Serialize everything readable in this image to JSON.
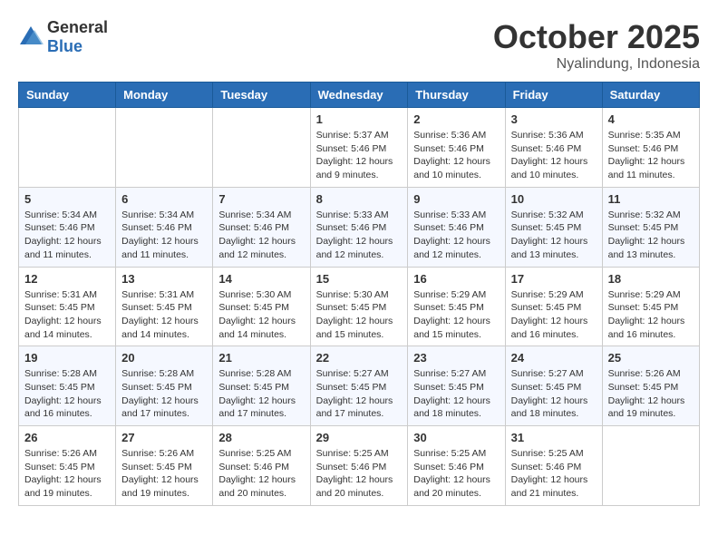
{
  "header": {
    "logo_general": "General",
    "logo_blue": "Blue",
    "month": "October 2025",
    "location": "Nyalindung, Indonesia"
  },
  "days_of_week": [
    "Sunday",
    "Monday",
    "Tuesday",
    "Wednesday",
    "Thursday",
    "Friday",
    "Saturday"
  ],
  "weeks": [
    [
      {
        "day": "",
        "info": ""
      },
      {
        "day": "",
        "info": ""
      },
      {
        "day": "",
        "info": ""
      },
      {
        "day": "1",
        "info": "Sunrise: 5:37 AM\nSunset: 5:46 PM\nDaylight: 12 hours and 9 minutes."
      },
      {
        "day": "2",
        "info": "Sunrise: 5:36 AM\nSunset: 5:46 PM\nDaylight: 12 hours and 10 minutes."
      },
      {
        "day": "3",
        "info": "Sunrise: 5:36 AM\nSunset: 5:46 PM\nDaylight: 12 hours and 10 minutes."
      },
      {
        "day": "4",
        "info": "Sunrise: 5:35 AM\nSunset: 5:46 PM\nDaylight: 12 hours and 11 minutes."
      }
    ],
    [
      {
        "day": "5",
        "info": "Sunrise: 5:34 AM\nSunset: 5:46 PM\nDaylight: 12 hours and 11 minutes."
      },
      {
        "day": "6",
        "info": "Sunrise: 5:34 AM\nSunset: 5:46 PM\nDaylight: 12 hours and 11 minutes."
      },
      {
        "day": "7",
        "info": "Sunrise: 5:34 AM\nSunset: 5:46 PM\nDaylight: 12 hours and 12 minutes."
      },
      {
        "day": "8",
        "info": "Sunrise: 5:33 AM\nSunset: 5:46 PM\nDaylight: 12 hours and 12 minutes."
      },
      {
        "day": "9",
        "info": "Sunrise: 5:33 AM\nSunset: 5:46 PM\nDaylight: 12 hours and 12 minutes."
      },
      {
        "day": "10",
        "info": "Sunrise: 5:32 AM\nSunset: 5:45 PM\nDaylight: 12 hours and 13 minutes."
      },
      {
        "day": "11",
        "info": "Sunrise: 5:32 AM\nSunset: 5:45 PM\nDaylight: 12 hours and 13 minutes."
      }
    ],
    [
      {
        "day": "12",
        "info": "Sunrise: 5:31 AM\nSunset: 5:45 PM\nDaylight: 12 hours and 14 minutes."
      },
      {
        "day": "13",
        "info": "Sunrise: 5:31 AM\nSunset: 5:45 PM\nDaylight: 12 hours and 14 minutes."
      },
      {
        "day": "14",
        "info": "Sunrise: 5:30 AM\nSunset: 5:45 PM\nDaylight: 12 hours and 14 minutes."
      },
      {
        "day": "15",
        "info": "Sunrise: 5:30 AM\nSunset: 5:45 PM\nDaylight: 12 hours and 15 minutes."
      },
      {
        "day": "16",
        "info": "Sunrise: 5:29 AM\nSunset: 5:45 PM\nDaylight: 12 hours and 15 minutes."
      },
      {
        "day": "17",
        "info": "Sunrise: 5:29 AM\nSunset: 5:45 PM\nDaylight: 12 hours and 16 minutes."
      },
      {
        "day": "18",
        "info": "Sunrise: 5:29 AM\nSunset: 5:45 PM\nDaylight: 12 hours and 16 minutes."
      }
    ],
    [
      {
        "day": "19",
        "info": "Sunrise: 5:28 AM\nSunset: 5:45 PM\nDaylight: 12 hours and 16 minutes."
      },
      {
        "day": "20",
        "info": "Sunrise: 5:28 AM\nSunset: 5:45 PM\nDaylight: 12 hours and 17 minutes."
      },
      {
        "day": "21",
        "info": "Sunrise: 5:28 AM\nSunset: 5:45 PM\nDaylight: 12 hours and 17 minutes."
      },
      {
        "day": "22",
        "info": "Sunrise: 5:27 AM\nSunset: 5:45 PM\nDaylight: 12 hours and 17 minutes."
      },
      {
        "day": "23",
        "info": "Sunrise: 5:27 AM\nSunset: 5:45 PM\nDaylight: 12 hours and 18 minutes."
      },
      {
        "day": "24",
        "info": "Sunrise: 5:27 AM\nSunset: 5:45 PM\nDaylight: 12 hours and 18 minutes."
      },
      {
        "day": "25",
        "info": "Sunrise: 5:26 AM\nSunset: 5:45 PM\nDaylight: 12 hours and 19 minutes."
      }
    ],
    [
      {
        "day": "26",
        "info": "Sunrise: 5:26 AM\nSunset: 5:45 PM\nDaylight: 12 hours and 19 minutes."
      },
      {
        "day": "27",
        "info": "Sunrise: 5:26 AM\nSunset: 5:45 PM\nDaylight: 12 hours and 19 minutes."
      },
      {
        "day": "28",
        "info": "Sunrise: 5:25 AM\nSunset: 5:46 PM\nDaylight: 12 hours and 20 minutes."
      },
      {
        "day": "29",
        "info": "Sunrise: 5:25 AM\nSunset: 5:46 PM\nDaylight: 12 hours and 20 minutes."
      },
      {
        "day": "30",
        "info": "Sunrise: 5:25 AM\nSunset: 5:46 PM\nDaylight: 12 hours and 20 minutes."
      },
      {
        "day": "31",
        "info": "Sunrise: 5:25 AM\nSunset: 5:46 PM\nDaylight: 12 hours and 21 minutes."
      },
      {
        "day": "",
        "info": ""
      }
    ]
  ]
}
